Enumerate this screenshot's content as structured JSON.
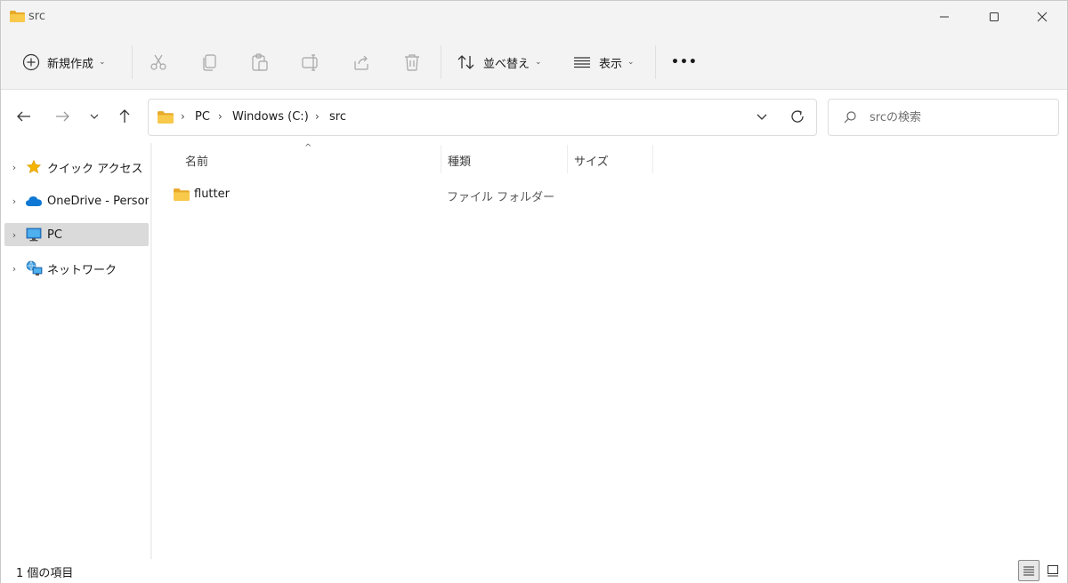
{
  "window": {
    "title": "src"
  },
  "toolbar": {
    "new_label": "新規作成",
    "sort_label": "並べ替え",
    "view_label": "表示",
    "more_label": "•••"
  },
  "address": {
    "crumbs": [
      "PC",
      "Windows (C:)",
      "src"
    ]
  },
  "search": {
    "placeholder": "srcの検索"
  },
  "sidebar": {
    "items": [
      {
        "label": "クイック アクセス",
        "icon": "star-icon"
      },
      {
        "label": "OneDrive - Personal",
        "icon": "onedrive-cloud-icon"
      },
      {
        "label": "PC",
        "icon": "pc-monitor-icon",
        "selected": true
      },
      {
        "label": "ネットワーク",
        "icon": "network-icon"
      }
    ]
  },
  "columns": {
    "name": "名前",
    "type": "種類",
    "size": "サイズ"
  },
  "files": [
    {
      "name": "flutter",
      "type": "ファイル フォルダー",
      "icon": "folder-icon"
    }
  ],
  "status": {
    "item_count": "1 個の項目"
  },
  "colors": {
    "folder": "#f5c542",
    "accent": "#0067c0",
    "selected_bg": "#dadada"
  }
}
